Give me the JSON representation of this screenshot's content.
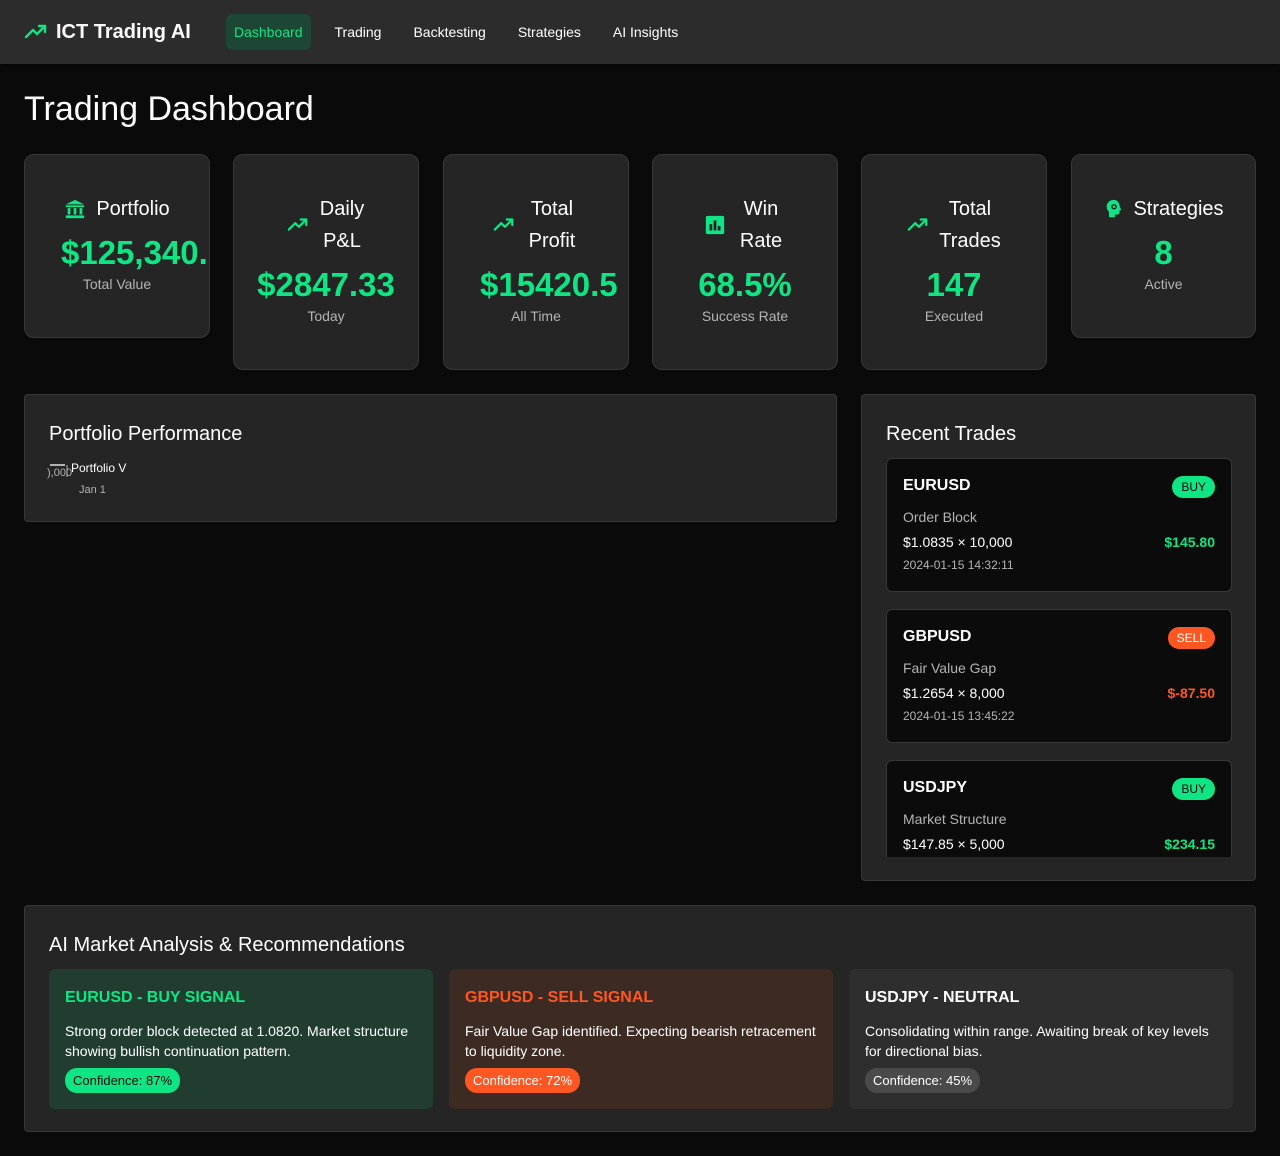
{
  "colors": {
    "accent": "#10e584",
    "sell": "#ff5722",
    "background": "#0a0a0a",
    "card": "#252525",
    "topbar": "#2c2c2c",
    "muted_text": "#b3b3b3"
  },
  "app": {
    "brand_icon": "trending-up-icon",
    "title": "ICT Trading AI"
  },
  "nav": {
    "items": [
      {
        "label": "Dashboard",
        "active": true
      },
      {
        "label": "Trading",
        "active": false
      },
      {
        "label": "Backtesting",
        "active": false
      },
      {
        "label": "Strategies",
        "active": false
      },
      {
        "label": "AI Insights",
        "active": false
      }
    ]
  },
  "page": {
    "title": "Trading Dashboard"
  },
  "stats": [
    {
      "icon": "bank-icon",
      "title": "Portfolio",
      "value": "$125,340.",
      "sub": "Total Value"
    },
    {
      "icon": "trending-up-icon",
      "title": "Daily P&L",
      "value": "$2847.33",
      "sub": "Today"
    },
    {
      "icon": "trending-up-icon",
      "title": "Total Profit",
      "value": "$15420.5",
      "sub": "All Time"
    },
    {
      "icon": "bar-chart-icon",
      "title": "Win Rate",
      "value": "68.5%",
      "sub": "Success Rate"
    },
    {
      "icon": "trending-up-icon",
      "title": "Total Trades",
      "value": "147",
      "sub": "Executed"
    },
    {
      "icon": "ai-brain-icon",
      "title": "Strategies",
      "value": "8",
      "sub": "Active"
    }
  ],
  "performance": {
    "title": "Portfolio Performance",
    "legend_label": "Portfolio V",
    "y_tick_fragment": "),000",
    "x_tick_fragment": "Jan 1"
  },
  "recent_trades": {
    "title": "Recent Trades",
    "items": [
      {
        "pair": "EURUSD",
        "side": "BUY",
        "strategy": "Order Block",
        "price": "$1.0835 × 10,000",
        "pnl": "$145.80",
        "time": "2024-01-15 14:32:11"
      },
      {
        "pair": "GBPUSD",
        "side": "SELL",
        "strategy": "Fair Value Gap",
        "price": "$1.2654 × 8,000",
        "pnl": "$-87.50",
        "time": "2024-01-15 13:45:22"
      },
      {
        "pair": "USDJPY",
        "side": "BUY",
        "strategy": "Market Structure",
        "price": "$147.85 × 5,000",
        "pnl": "$234.15",
        "time": ""
      }
    ]
  },
  "ai_analysis": {
    "title": "AI Market Analysis & Recommendations",
    "cards": [
      {
        "kind": "buy",
        "heading": "EURUSD - BUY SIGNAL",
        "body": "Strong order block detected at 1.0820. Market structure showing bullish continuation pattern.",
        "confidence": "Confidence: 87%"
      },
      {
        "kind": "sell",
        "heading": "GBPUSD - SELL SIGNAL",
        "body": "Fair Value Gap identified. Expecting bearish retracement to liquidity zone.",
        "confidence": "Confidence: 72%"
      },
      {
        "kind": "neutral",
        "heading": "USDJPY - NEUTRAL",
        "body": "Consolidating within range. Awaiting break of key levels for directional bias.",
        "confidence": "Confidence: 45%"
      }
    ]
  }
}
